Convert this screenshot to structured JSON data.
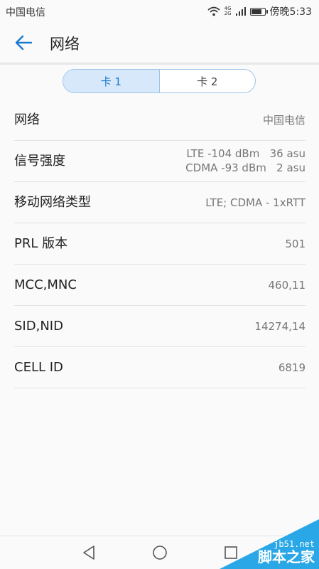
{
  "status_bar": {
    "carrier": "中国电信",
    "network_small_top": "4G",
    "network_small_bottom": "2G",
    "time": "傍晚5:33"
  },
  "header": {
    "title": "网络"
  },
  "tabs": [
    {
      "label": "卡 1",
      "active": true
    },
    {
      "label": "卡 2",
      "active": false
    }
  ],
  "rows": [
    {
      "label": "网络",
      "value": "中国电信"
    },
    {
      "label": "信号强度",
      "value_line1": "LTE -104 dBm   36 asu",
      "value_line2": "CDMA -93 dBm   2 asu"
    },
    {
      "label": "移动网络类型",
      "value": "LTE; CDMA - 1xRTT"
    },
    {
      "label": "PRL 版本",
      "value": "501"
    },
    {
      "label": "MCC,MNC",
      "value": "460,11"
    },
    {
      "label": "SID,NID",
      "value": "14274,14"
    },
    {
      "label": "CELL ID",
      "value": "6819"
    }
  ],
  "watermark": {
    "domain": "jb51.net",
    "name": "脚本之家"
  },
  "colors": {
    "accent": "#1a7ad0",
    "tab_active_bg": "#d6e8fa",
    "watermark": "#29a7e6"
  },
  "icons": [
    "wifi-icon",
    "battery-icon",
    "back-arrow-icon",
    "nav-back-icon",
    "nav-home-icon",
    "nav-recents-icon"
  ]
}
